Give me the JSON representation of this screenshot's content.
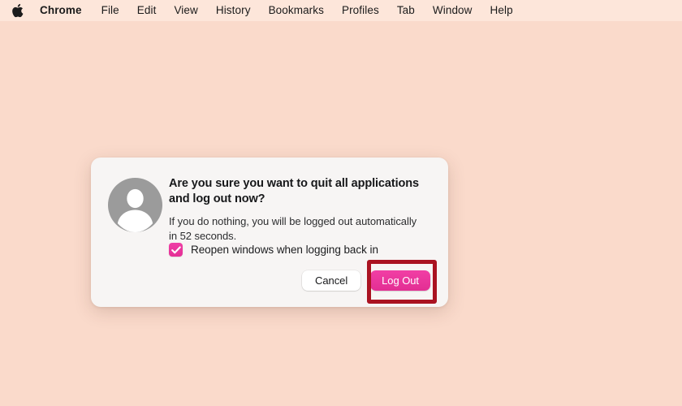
{
  "menubar": {
    "apple_icon": "apple-logo-icon",
    "app_name": "Chrome",
    "items": [
      {
        "label": "File"
      },
      {
        "label": "Edit"
      },
      {
        "label": "View"
      },
      {
        "label": "History"
      },
      {
        "label": "Bookmarks"
      },
      {
        "label": "Profiles"
      },
      {
        "label": "Tab"
      },
      {
        "label": "Window"
      },
      {
        "label": "Help"
      }
    ]
  },
  "dialog": {
    "avatar_icon": "user-avatar-icon",
    "title": "Are you sure you want to quit all applications and log out now?",
    "subtitle": "If you do nothing, you will be logged out automatically in 52 seconds.",
    "countdown_seconds": "52",
    "checkbox": {
      "label": "Reopen windows when logging back in",
      "checked": true,
      "check_icon": "checkmark-icon"
    },
    "cancel_label": "Cancel",
    "logout_label": "Log Out"
  },
  "annotation": {
    "highlight_target": "Log Out",
    "highlight_color": "#aa1321"
  },
  "colors": {
    "desktop_background": "#fadacb",
    "menubar_background": "#fde6da",
    "dialog_background": "#f7f5f4",
    "accent_pink": "#e8359c",
    "avatar_gray": "#9b9b9b",
    "highlight_red": "#aa1321"
  }
}
